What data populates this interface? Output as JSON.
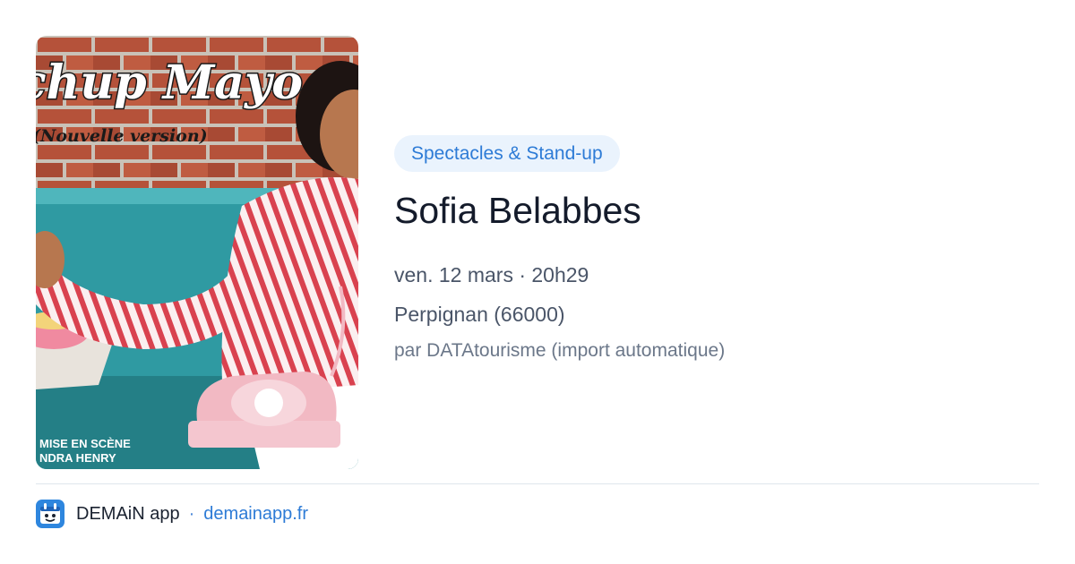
{
  "event": {
    "category": "Spectacles & Stand-up",
    "title": "Sofia Belabbes",
    "date_time": "ven. 12 mars · 20h29",
    "location": "Perpignan (66000)",
    "source": "par DATAtourisme (import automatique)"
  },
  "poster": {
    "headline": "chup Mayo",
    "subheadline": "(Nouvelle version)",
    "credit_line_1": "MISE EN SCÈNE",
    "credit_line_2": "NDRA HENRY"
  },
  "footer": {
    "app_name": "DEMAiN app",
    "separator": "·",
    "domain": "demainapp.fr",
    "icon": "demain-app-icon"
  },
  "colors": {
    "accent": "#2d7bd6",
    "category_bg": "#eaf3fd",
    "brick": "#b5523a",
    "booth_teal": "#2f9aa2",
    "phone_pink": "#f2b9c3"
  }
}
